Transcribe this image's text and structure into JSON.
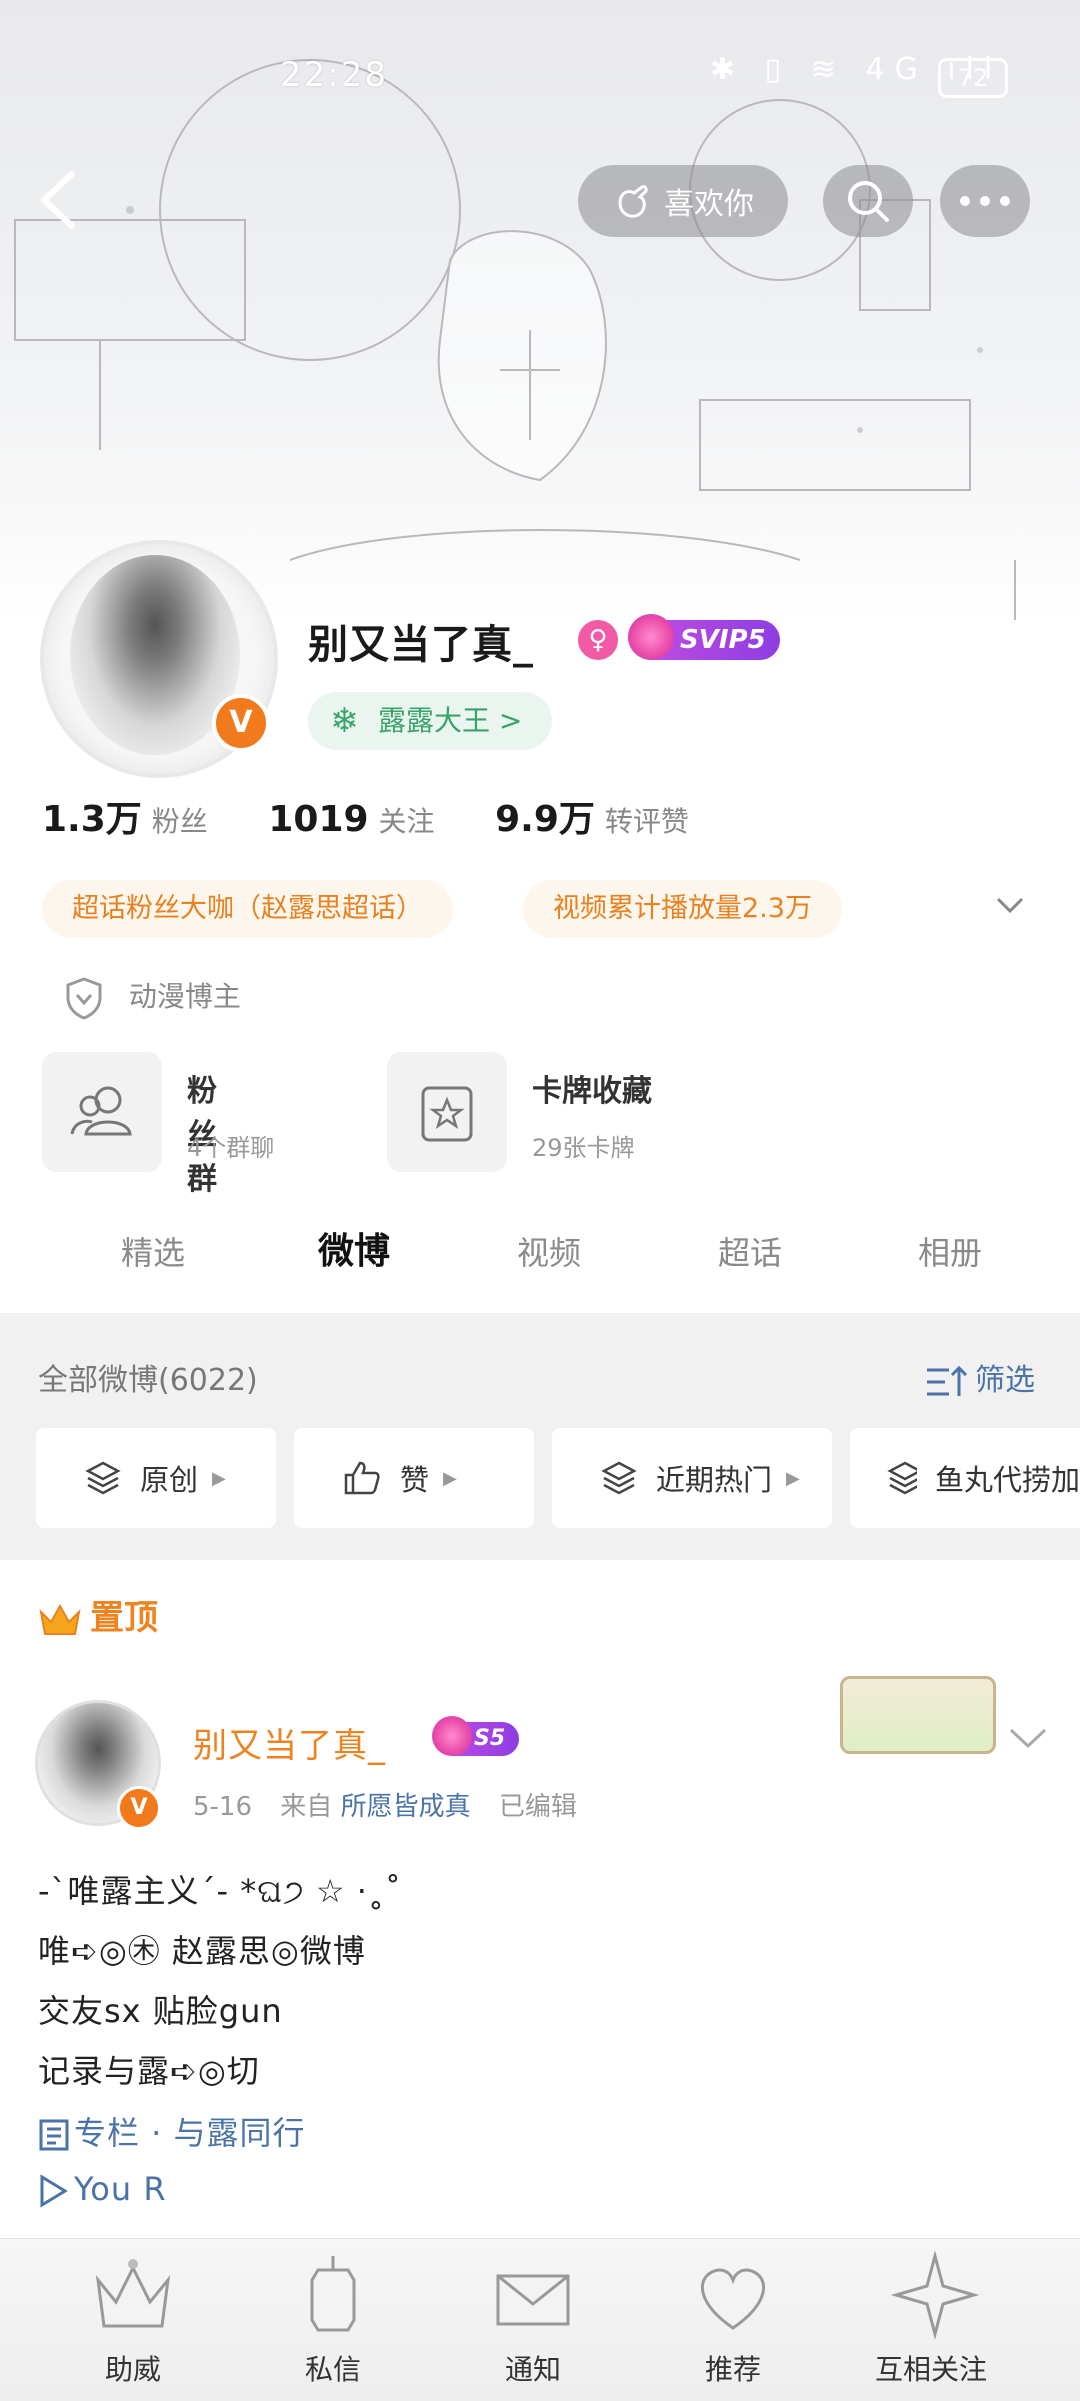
{
  "status_bar": {
    "time": "22:28",
    "icons": "✱ ▯ ≋ 4G ıll",
    "battery": "72"
  },
  "header": {
    "like_label": "喜欢你"
  },
  "profile": {
    "name": "别又当了真_",
    "vip_badge": "SVIP5",
    "fan_title": "露露大王 >",
    "stats": [
      {
        "value": "1.3万",
        "label": "粉丝"
      },
      {
        "value": "1019",
        "label": "关注"
      },
      {
        "value": "9.9万",
        "label": "转评赞"
      }
    ],
    "tags": [
      "超话粉丝大咖（赵露思超话）",
      "视频累计播放量2.3万"
    ],
    "category": "动漫博主"
  },
  "tiles": [
    {
      "title": "粉丝群",
      "subtitle": "4个群聊"
    },
    {
      "title": "卡牌收藏",
      "subtitle": "29张卡牌"
    }
  ],
  "tabs": [
    "精选",
    "微博",
    "视频",
    "超话",
    "相册"
  ],
  "feed": {
    "count_label": "全部微博(6022)",
    "filter_label": "筛选",
    "chips": [
      "原创",
      "赞",
      "近期热门",
      "鱼丸代捞加"
    ]
  },
  "pinned": {
    "label": "置顶",
    "author": "别又当了真_",
    "author_badge": "S5",
    "date": "5-16",
    "from_label": "来自",
    "source": "所愿皆成真",
    "edited": "已编辑",
    "lines": [
      "-`唯露主义´- *ଘ੭ ☆ ·˳˚",
      "唯➪◎㊍ 赵露思◎微博",
      "交友sx 贴脸gun",
      "记录与露➪◎切"
    ],
    "column_link": "专栏 · 与露同行",
    "video_link": "You R"
  },
  "bottom_nav": [
    "助威",
    "私信",
    "通知",
    "推荐",
    "互相关注"
  ],
  "colors": {
    "accent_orange": "#f0821e",
    "link_blue": "#4a73a8",
    "fan_green": "#3aa36b",
    "vip_purple": "#a845e3"
  }
}
